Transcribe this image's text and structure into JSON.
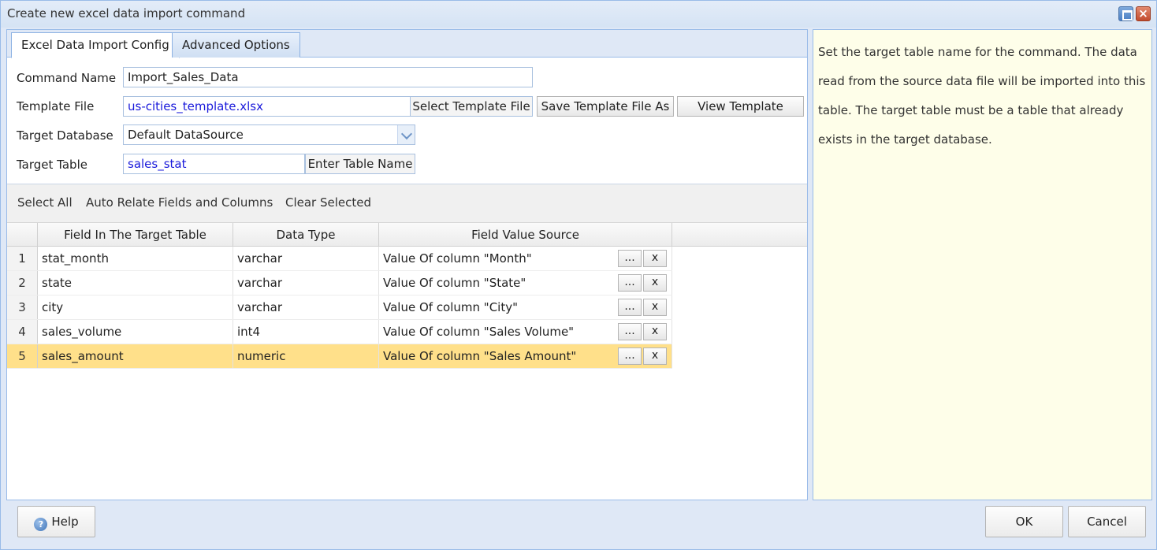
{
  "window": {
    "title": "Create new excel data import command"
  },
  "tabs": [
    {
      "label": "Excel Data Import Config",
      "active": true
    },
    {
      "label": "Advanced Options",
      "active": false
    }
  ],
  "form": {
    "command_name": {
      "label": "Command Name",
      "value": "Import_Sales_Data"
    },
    "template_file": {
      "label": "Template File",
      "value": "us-cities_template.xlsx",
      "select_button": "Select Template File",
      "save_button": "Save Template File As",
      "view_button": "View Template"
    },
    "target_database": {
      "label": "Target Database",
      "value": "Default DataSource"
    },
    "target_table": {
      "label": "Target Table",
      "value": "sales_stat",
      "enter_button": "Enter Table Name"
    }
  },
  "toolbar": {
    "select_all": "Select All",
    "auto_relate": "Auto Relate Fields and Columns",
    "clear_selected": "Clear Selected"
  },
  "grid": {
    "columns": [
      "Field In The Target Table",
      "Data Type",
      "Field Value Source"
    ],
    "rows": [
      {
        "num": "1",
        "field": "stat_month",
        "type": "varchar",
        "source": "Value Of column \"Month\""
      },
      {
        "num": "2",
        "field": "state",
        "type": "varchar",
        "source": "Value Of column \"State\""
      },
      {
        "num": "3",
        "field": "city",
        "type": "varchar",
        "source": "Value Of column \"City\""
      },
      {
        "num": "4",
        "field": "sales_volume",
        "type": "int4",
        "source": "Value Of column \"Sales Volume\""
      },
      {
        "num": "5",
        "field": "sales_amount",
        "type": "numeric",
        "source": "Value Of column \"Sales Amount\""
      }
    ],
    "selected_row": "5",
    "browse_label": "...",
    "remove_label": "x"
  },
  "help_text": "Set the target table name for the command. The data read from the source data file will be imported into this table. The target table must be a table that already exists in the target database.",
  "footer": {
    "help": "Help",
    "ok": "OK",
    "cancel": "Cancel"
  },
  "colors": {
    "selected_row": "#ffe08a",
    "help_background": "#fefee9",
    "link_text": "#1a1adb"
  }
}
